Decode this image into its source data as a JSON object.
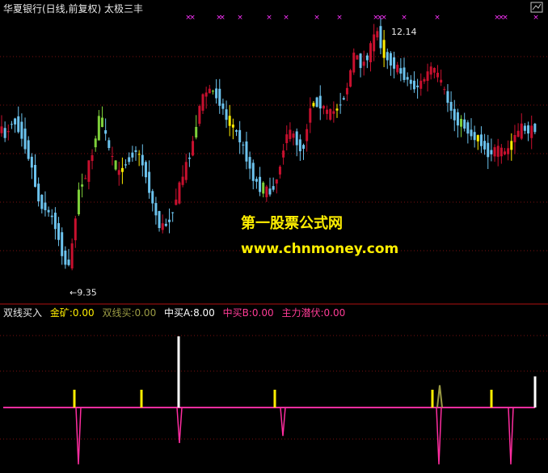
{
  "header": {
    "title": "华夏银行(日线,前复权) 太极三丰"
  },
  "indicator_header": {
    "name": "双线买入",
    "items": [
      {
        "label": "金矿:",
        "value": "0.00",
        "color": "#ffee00"
      },
      {
        "label": "双线买:",
        "value": "0.00",
        "color": "#9c9c44"
      },
      {
        "label": "中买A:",
        "value": "8.00",
        "color": "#ffffff"
      },
      {
        "label": "中买B:",
        "value": "0.00",
        "color": "#ff3c96"
      },
      {
        "label": "主力潜伏:",
        "value": "0.00",
        "color": "#ff3c96"
      }
    ]
  },
  "watermark": {
    "line1": "第一股票公式网",
    "line2": "www.chnmoney.com"
  },
  "colors": {
    "up": "#c8102e",
    "down": "#6cc3ee",
    "yellow": "#ffee00",
    "green": "#7ed03a",
    "magenta": "#ff2da0",
    "olive": "#9c9c44",
    "white": "#ffffff",
    "grid": "#7a0f0f",
    "pane_border": "#b01010",
    "marker": "#ff33ff"
  },
  "chart_data": [
    {
      "type": "candlestick",
      "title": "华夏银行(日线,前复权) 太极三丰",
      "annotations": [
        {
          "text": "12.14",
          "kind": "high"
        },
        {
          "text": "9.35",
          "kind": "low"
        }
      ],
      "ylim": [
        9.0,
        12.3
      ],
      "high_value": 12.14,
      "low_value": 9.35,
      "price_path": [
        [
          0,
          11.05
        ],
        [
          10,
          10.9
        ],
        [
          20,
          11.1
        ],
        [
          30,
          10.95
        ],
        [
          42,
          10.6
        ],
        [
          52,
          10.15
        ],
        [
          62,
          10.05
        ],
        [
          72,
          9.9
        ],
        [
          80,
          9.6
        ],
        [
          86,
          9.4
        ],
        [
          92,
          9.5
        ],
        [
          100,
          10.25
        ],
        [
          110,
          10.45
        ],
        [
          118,
          10.7
        ],
        [
          126,
          11.1
        ],
        [
          132,
          11.0
        ],
        [
          140,
          10.7
        ],
        [
          150,
          10.45
        ],
        [
          160,
          10.6
        ],
        [
          172,
          10.75
        ],
        [
          182,
          10.55
        ],
        [
          192,
          10.15
        ],
        [
          202,
          9.85
        ],
        [
          212,
          9.9
        ],
        [
          222,
          10.2
        ],
        [
          232,
          10.5
        ],
        [
          242,
          10.8
        ],
        [
          252,
          11.3
        ],
        [
          262,
          11.45
        ],
        [
          274,
          11.35
        ],
        [
          284,
          11.1
        ],
        [
          296,
          10.95
        ],
        [
          306,
          10.75
        ],
        [
          316,
          10.45
        ],
        [
          326,
          10.3
        ],
        [
          338,
          10.25
        ],
        [
          348,
          10.45
        ],
        [
          358,
          10.95
        ],
        [
          368,
          10.9
        ],
        [
          378,
          10.7
        ],
        [
          388,
          11.25
        ],
        [
          398,
          11.3
        ],
        [
          410,
          11.15
        ],
        [
          420,
          11.2
        ],
        [
          432,
          11.4
        ],
        [
          442,
          11.85
        ],
        [
          452,
          11.7
        ],
        [
          462,
          11.9
        ],
        [
          470,
          12.14
        ],
        [
          478,
          11.85
        ],
        [
          488,
          11.75
        ],
        [
          498,
          11.65
        ],
        [
          508,
          11.55
        ],
        [
          518,
          11.45
        ],
        [
          528,
          11.55
        ],
        [
          538,
          11.7
        ],
        [
          548,
          11.55
        ],
        [
          558,
          11.3
        ],
        [
          566,
          11.1
        ],
        [
          576,
          11.05
        ],
        [
          588,
          10.9
        ],
        [
          598,
          10.85
        ],
        [
          608,
          10.7
        ],
        [
          618,
          10.75
        ],
        [
          630,
          10.7
        ],
        [
          640,
          10.9
        ],
        [
          650,
          11.0
        ],
        [
          660,
          10.95
        ],
        [
          665,
          11.0
        ]
      ],
      "marker_positions": [
        233,
        238,
        271,
        275,
        297,
        333,
        354,
        392,
        420,
        465,
        470,
        475,
        500,
        541,
        615,
        620,
        625,
        663
      ]
    },
    {
      "type": "bar",
      "title": "双线买入",
      "series": [
        {
          "name": "金矿",
          "x": [
            92,
            175,
            340,
            535,
            608
          ],
          "values": [
            2,
            2,
            2,
            2,
            2
          ],
          "color": "#ffee00"
        },
        {
          "name": "中买A",
          "x": [
            221,
            662
          ],
          "values": [
            8,
            3.5
          ],
          "color": "#ffffff"
        },
        {
          "name": "双线买",
          "x": [
            544
          ],
          "values": [
            2.5
          ],
          "color": "#9c9c44"
        },
        {
          "name": "主力潜伏",
          "x": [
            97,
            222,
            350,
            543,
            632
          ],
          "values": [
            -4,
            -2.5,
            -2,
            -4,
            -4
          ],
          "color": "#ff2da0"
        }
      ]
    }
  ]
}
